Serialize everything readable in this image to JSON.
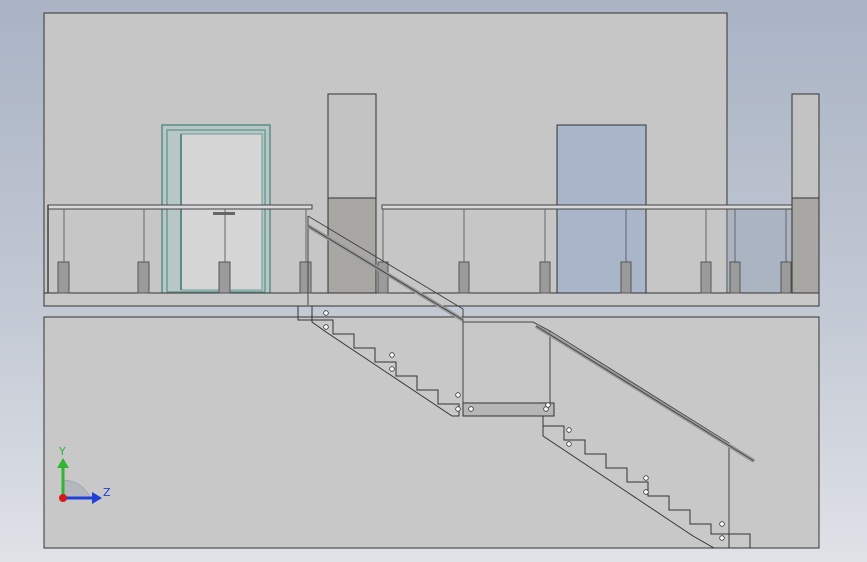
{
  "viewport": {
    "view": "front",
    "model": "staircase-with-landing-and-glass-railing"
  },
  "triad": {
    "y_label": "Y",
    "z_label": "Z",
    "y_color": "#2fb52f",
    "z_color": "#1f3fd6",
    "origin_color": "#d11b1b"
  },
  "colors": {
    "background_top": "#a9b3c4",
    "wall": "#c6c6c6",
    "glass": "#a9b5c8",
    "pillar": "#a9a7a3",
    "door_frame": "#6f9c96",
    "line": "#333333"
  }
}
